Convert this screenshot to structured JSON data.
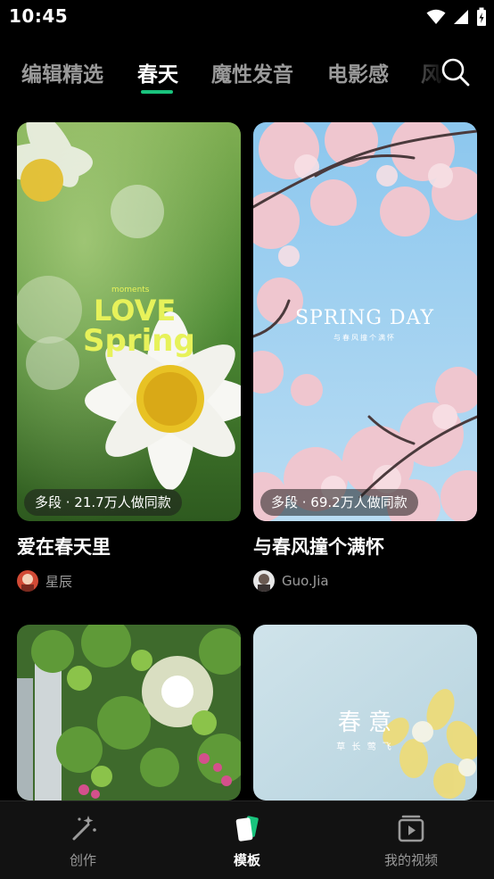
{
  "status_bar": {
    "time": "10:45"
  },
  "tabs": [
    {
      "label": "编辑精选",
      "active": false
    },
    {
      "label": "春天",
      "active": true
    },
    {
      "label": "魔性发音",
      "active": false
    },
    {
      "label": "电影感",
      "active": false
    },
    {
      "label": "风",
      "active": false
    }
  ],
  "cards": [
    {
      "title": "爱在春天里",
      "meta": "多段 · 21.7万人做同款",
      "author": "星辰",
      "overlay_small": "moments",
      "overlay_line1": "LOVE",
      "overlay_line2": "Spring"
    },
    {
      "title": "与春风撞个满怀",
      "meta": "多段 · 69.2万人做同款",
      "author": "Guo.Jia",
      "overlay_title": "SPRING DAY",
      "overlay_sub": "与春风撞个满怀"
    },
    {
      "title": "",
      "meta": "",
      "author": ""
    },
    {
      "title": "",
      "meta": "",
      "author": "",
      "overlay_title": "春 意",
      "overlay_sub": "草 长 莺 飞"
    }
  ],
  "bottom_nav": [
    {
      "label": "创作",
      "icon": "magic-wand-icon",
      "active": false
    },
    {
      "label": "模板",
      "icon": "template-icon",
      "active": true
    },
    {
      "label": "我的视频",
      "icon": "my-videos-icon",
      "active": false
    }
  ],
  "colors": {
    "accent": "#19c37d",
    "background": "#000000",
    "nav_background": "#121212"
  }
}
